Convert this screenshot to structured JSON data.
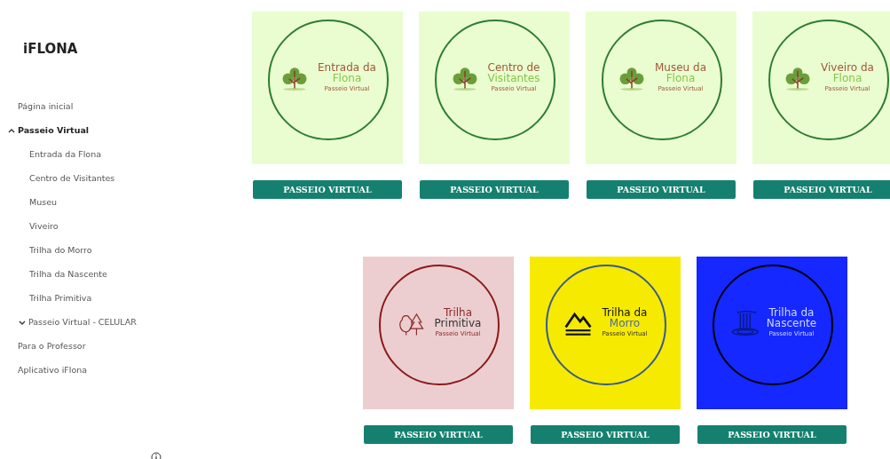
{
  "sidebar": {
    "logo": "iFLONA",
    "items": [
      {
        "label": "Página inicial",
        "selected": false
      },
      {
        "label": "Passeio Virtual",
        "selected": true,
        "expanded": true,
        "children": [
          {
            "label": "Entrada da Flona"
          },
          {
            "label": "Centro de Visitantes"
          },
          {
            "label": "Museu"
          },
          {
            "label": "Viveiro"
          },
          {
            "label": "Trilha do Morro"
          },
          {
            "label": "Trilha da Nascente"
          },
          {
            "label": "Trilha Primitiva"
          }
        ]
      },
      {
        "label": "Passeio Virtual - CELULAR",
        "selected": false,
        "expanded": false
      },
      {
        "label": "Para o Professor",
        "selected": false
      },
      {
        "label": "Aplicativo iFlona",
        "selected": false
      }
    ]
  },
  "rows": [
    {
      "cards": [
        {
          "kind": "tree",
          "line1": "Entrada da",
          "line2": "Flona",
          "subtitle": "Passeio Virtual",
          "button": "PASSEIO VIRTUAL"
        },
        {
          "kind": "tree",
          "line1": "Centro de",
          "line2": "Visitantes",
          "subtitle": "Passeio Virtual",
          "button": "PASSEIO VIRTUAL"
        },
        {
          "kind": "tree",
          "line1": "Museu da",
          "line2": "Flona",
          "subtitle": "Passeio Virtual",
          "button": "PASSEIO VIRTUAL"
        },
        {
          "kind": "tree",
          "line1": "Viveiro da",
          "line2": "Flona",
          "subtitle": "Passeio Virtual",
          "button": "PASSEIO VIRTUAL"
        }
      ]
    },
    {
      "cards": [
        {
          "kind": "trees",
          "line1": "Trilha",
          "line2": "Primitiva",
          "subtitle": "Passeio Virtual",
          "button": "PASSEIO VIRTUAL"
        },
        {
          "kind": "mountain",
          "line1": "Trilha da",
          "line2": "Morro",
          "subtitle": "Passeio Virtual",
          "button": "PASSEIO VIRTUAL"
        },
        {
          "kind": "waterfall",
          "line1": "Trilha da",
          "line2": "Nascente",
          "subtitle": "Passeio Virtual",
          "button": "PASSEIO VIRTUAL"
        }
      ]
    }
  ]
}
